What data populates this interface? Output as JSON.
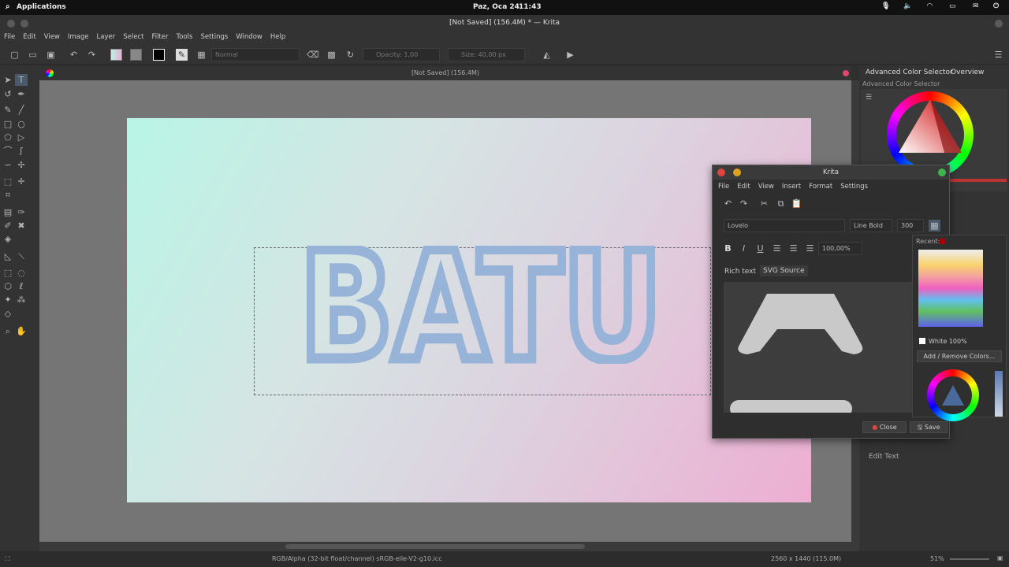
{
  "topbar": {
    "apps": "Applications",
    "date": "Paz, Oca 24",
    "time": "11:43"
  },
  "window": {
    "title": "[Not Saved]  (156.4M) * — Krita"
  },
  "menu": [
    "File",
    "Edit",
    "View",
    "Image",
    "Layer",
    "Select",
    "Filter",
    "Tools",
    "Settings",
    "Window",
    "Help"
  ],
  "toolbar": {
    "blend_mode": "Normal",
    "opacity": "Opacity:  1,00",
    "size": "Size:  40,00 px"
  },
  "document": {
    "tab_title": "[Not Saved]  (156.4M)",
    "text": "BATU"
  },
  "right_panel": {
    "tab1": "Advanced Color Selector",
    "tab2": "Overview",
    "docker_title": "Advanced Color Selector",
    "edit_text": "Edit Text"
  },
  "dialog": {
    "title": "Krita",
    "menu": [
      "File",
      "Edit",
      "View",
      "Insert",
      "Format",
      "Settings"
    ],
    "font": "Lovelo",
    "weight": "Line Bold",
    "size": "300",
    "zoom": "100,00%",
    "tab_rich": "Rich text",
    "tab_svg": "SVG Source",
    "close": "Close",
    "save": "Save"
  },
  "popup": {
    "recent": "Recent:",
    "color_name": "White 100%",
    "add_remove": "Add / Remove Colors..."
  },
  "status": {
    "colorspace": "RGB/Alpha (32-bit float/channel)  sRGB-elle-V2-g10.icc",
    "size": "2560 x 1440 (115.0M)",
    "zoom": "51%"
  },
  "colors": {
    "accent": "#4a90d9",
    "text_fill": "#97b4d8"
  }
}
